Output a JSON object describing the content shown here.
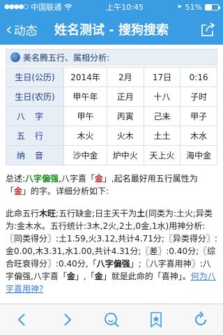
{
  "status": {
    "carrier": "中国联通",
    "time": "上午10:45",
    "battery": "51%",
    "battery_level": 0.51
  },
  "nav": {
    "back_label": "动态",
    "title": "姓名测试 - 搜狗搜索"
  },
  "section": {
    "title": "美名腾五行、属相分析:"
  },
  "bazi": {
    "rows": [
      {
        "label": "生日(公历)",
        "cells": [
          "2014年",
          "2月",
          "17日",
          "0:16"
        ],
        "spaced": false
      },
      {
        "label": "生日(农历)",
        "cells": [
          "甲午年",
          "正月",
          "十八",
          "子时"
        ],
        "spaced": false
      },
      {
        "label": "八字",
        "cells": [
          "甲午",
          "丙寅",
          "己未",
          "甲子"
        ],
        "spaced": true
      },
      {
        "label": "五行",
        "cells": [
          "木火",
          "火木",
          "土土",
          "木水"
        ],
        "spaced": true
      },
      {
        "label": "纳音",
        "cells": [
          "沙中金",
          "炉中火",
          "天上火",
          "海中金"
        ],
        "spaced": true
      }
    ]
  },
  "summary": {
    "prefix": "总述:",
    "bazi_strength": "八字偏强",
    "part1": ",八字喜「",
    "xi_element": "金",
    "part2": "」,起名最好用五行属性为「",
    "name_element": "金",
    "part3": "」的字。详细分析如下:"
  },
  "detail": {
    "p1": "此命五行",
    "wood_strong": "木旺",
    "p2": ";五行缺金;日主天干为",
    "day_master": "土",
    "p3": "(同类为:土火;异类为:金木水。五行统计:3木,2火,2土,0金,1水)用神分析:〖同类得分〗:土1.59,火3.12,共计4.71分;〖异类得分〗:金0.00,木3.31,水1.00,共计4.31分;〖差〗:0.40分;〖综合旺衰得分〗:0.40分,「",
    "bazi_strength": "八字偏强",
    "p4": "」;〖八字喜用神〗:八字偏强,八字喜「",
    "xi_element": "金",
    "p5": "」,「",
    "xi_element2": "金",
    "p6": "」就是此命的「喜神」。",
    "link_text": "何为八字喜用神?"
  }
}
